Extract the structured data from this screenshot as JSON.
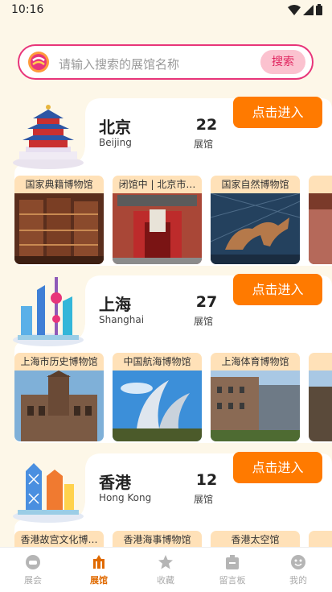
{
  "status_bar": {
    "time": "10:16"
  },
  "search": {
    "placeholder": "请输入搜索的展馆名称",
    "button": "搜索"
  },
  "cities": [
    {
      "name": "北京",
      "en": "Beijing",
      "count": "22",
      "count_label": "展馆",
      "enter": "点击进入",
      "museums": [
        "国家典籍博物馆",
        "闭馆中 | 北京市…",
        "国家自然博物馆",
        "中"
      ]
    },
    {
      "name": "上海",
      "en": "Shanghai",
      "count": "27",
      "count_label": "展馆",
      "enter": "点击进入",
      "museums": [
        "上海市历史博物馆",
        "中国航海博物馆",
        "上海体育博物馆",
        ""
      ]
    },
    {
      "name": "香港",
      "en": "Hong Kong",
      "count": "12",
      "count_label": "展馆",
      "enter": "点击进入",
      "museums": [
        "香港故宫文化博…",
        "香港海事博物馆",
        "香港太空馆",
        ""
      ]
    }
  ],
  "tabs": [
    {
      "label": "展会",
      "icon": "exhibition-icon"
    },
    {
      "label": "展馆",
      "icon": "museum-icon",
      "active": true
    },
    {
      "label": "收藏",
      "icon": "star-icon"
    },
    {
      "label": "留言板",
      "icon": "message-board-icon"
    },
    {
      "label": "我的",
      "icon": "profile-icon"
    }
  ]
}
